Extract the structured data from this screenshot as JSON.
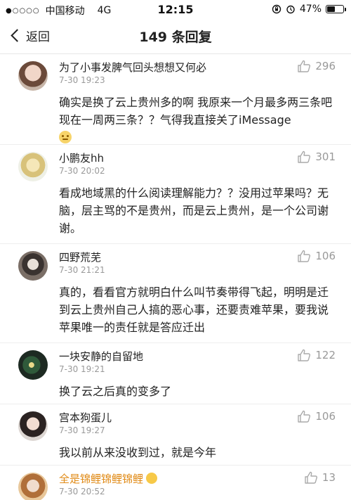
{
  "status_bar": {
    "signal": "●○○○○",
    "carrier": "中国移动",
    "network": "4G",
    "time": "12:15",
    "battery": "47%",
    "battery_level": 0.47
  },
  "nav": {
    "back_label": "返回",
    "title": "149 条回复"
  },
  "comments": [
    {
      "name": "为了小事发脾气回头想想又何必",
      "time": "7-30 19:23",
      "likes": "296",
      "text": "确实是换了云上贵州多的啊 我原来一个月最多两三条吧 现在一周两三条？？气得我直接关了iMessage"
    },
    {
      "name": "小鹏友hh",
      "time": "7-30 20:02",
      "likes": "301",
      "text": "看成地域黑的什么阅读理解能力？？没用过苹果吗？无脑，层主骂的不是贵州，而是云上贵州，是一个公司谢谢。"
    },
    {
      "name": "四野荒芜",
      "time": "7-30 21:21",
      "likes": "106",
      "text": "真的，看看官方就明白什么叫节奏带得飞起，明明是迁到云上贵州自己人搞的恶心事，还要责难苹果，要我说苹果唯一的责任就是答应迁出"
    },
    {
      "name": "一块安静的自留地",
      "time": "7-30 19:21",
      "likes": "122",
      "text": "换了云之后真的变多了"
    },
    {
      "name": "宫本狗蛋儿",
      "time": "7-30 19:27",
      "likes": "106",
      "text": "我以前从来没收到过，就是今年"
    },
    {
      "name": "全是锦鲤锦鲤锦鲤",
      "time": "7-30 20:52",
      "likes": "13",
      "text": ""
    }
  ],
  "colors": {
    "accent_gold": "#e08a16",
    "muted": "#999999"
  }
}
